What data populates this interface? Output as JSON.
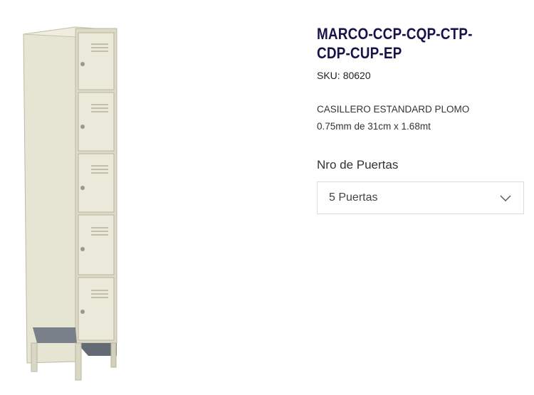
{
  "product": {
    "title": "MARCO-CCP-CQP-CTP-CDP-CUP-EP",
    "sku_label": "SKU:",
    "sku_value": "80620",
    "description_line1": "CASILLERO ESTANDARD PLOMO",
    "description_line2": "0.75mm de 31cm x 1.68mt"
  },
  "option": {
    "label": "Nro de Puertas",
    "selected": "5 Puertas"
  },
  "icons": {
    "select_chevron": "chevron-down-icon"
  },
  "colors": {
    "title": "#15134a",
    "locker_body": "#e8e6d6",
    "locker_shadow": "#cfcdb8",
    "locker_base": "#6e7480"
  }
}
